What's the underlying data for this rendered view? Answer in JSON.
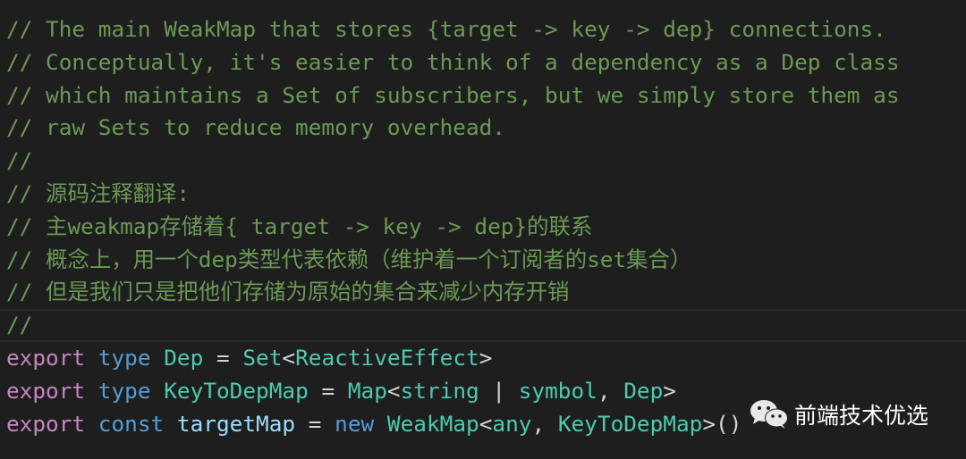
{
  "colors": {
    "background": "#1e1e1e",
    "comment": "#6a9955",
    "keyword": "#c586c0",
    "storage": "#569cd6",
    "type": "#4ec9b0",
    "variable": "#9cdcfe",
    "text": "#d4d4d4"
  },
  "code": {
    "current_line": 9,
    "lines": [
      {
        "tokens": [
          {
            "text": "// The main WeakMap that stores {target -> key -> dep} connections.",
            "cls": "comment"
          }
        ]
      },
      {
        "tokens": [
          {
            "text": "// Conceptually, it's easier to think of a dependency as a Dep class",
            "cls": "comment"
          }
        ]
      },
      {
        "tokens": [
          {
            "text": "// which maintains a Set of subscribers, but we simply store them as",
            "cls": "comment"
          }
        ]
      },
      {
        "tokens": [
          {
            "text": "// raw Sets to reduce memory overhead.",
            "cls": "comment"
          }
        ]
      },
      {
        "tokens": [
          {
            "text": "//",
            "cls": "comment"
          }
        ]
      },
      {
        "tokens": [
          {
            "text": "// 源码注释翻译:",
            "cls": "comment"
          }
        ]
      },
      {
        "tokens": [
          {
            "text": "// 主weakmap存储着{ target -> key -> dep}的联系",
            "cls": "comment"
          }
        ]
      },
      {
        "tokens": [
          {
            "text": "// 概念上，用一个dep类型代表依赖（维护着一个订阅者的set集合）",
            "cls": "comment"
          }
        ]
      },
      {
        "tokens": [
          {
            "text": "// 但是我们只是把他们存储为原始的集合来减少内存开销",
            "cls": "comment"
          }
        ]
      },
      {
        "tokens": [
          {
            "text": "//",
            "cls": "comment"
          }
        ]
      },
      {
        "tokens": [
          {
            "text": "export",
            "cls": "kw"
          },
          {
            "text": " ",
            "cls": "punct"
          },
          {
            "text": "type",
            "cls": "storage"
          },
          {
            "text": " ",
            "cls": "punct"
          },
          {
            "text": "Dep",
            "cls": "type"
          },
          {
            "text": " = ",
            "cls": "punct"
          },
          {
            "text": "Set",
            "cls": "type"
          },
          {
            "text": "<",
            "cls": "punct"
          },
          {
            "text": "ReactiveEffect",
            "cls": "type"
          },
          {
            "text": ">",
            "cls": "punct"
          }
        ]
      },
      {
        "tokens": [
          {
            "text": "export",
            "cls": "kw"
          },
          {
            "text": " ",
            "cls": "punct"
          },
          {
            "text": "type",
            "cls": "storage"
          },
          {
            "text": " ",
            "cls": "punct"
          },
          {
            "text": "KeyToDepMap",
            "cls": "type"
          },
          {
            "text": " = ",
            "cls": "punct"
          },
          {
            "text": "Map",
            "cls": "type"
          },
          {
            "text": "<",
            "cls": "punct"
          },
          {
            "text": "string",
            "cls": "type"
          },
          {
            "text": " | ",
            "cls": "punct"
          },
          {
            "text": "symbol",
            "cls": "type"
          },
          {
            "text": ", ",
            "cls": "punct"
          },
          {
            "text": "Dep",
            "cls": "type"
          },
          {
            "text": ">",
            "cls": "punct"
          }
        ]
      },
      {
        "tokens": [
          {
            "text": "export",
            "cls": "kw"
          },
          {
            "text": " ",
            "cls": "punct"
          },
          {
            "text": "const",
            "cls": "storage"
          },
          {
            "text": " ",
            "cls": "punct"
          },
          {
            "text": "targetMap",
            "cls": "var"
          },
          {
            "text": " = ",
            "cls": "punct"
          },
          {
            "text": "new",
            "cls": "storage"
          },
          {
            "text": " ",
            "cls": "punct"
          },
          {
            "text": "WeakMap",
            "cls": "type"
          },
          {
            "text": "<",
            "cls": "punct"
          },
          {
            "text": "any",
            "cls": "type"
          },
          {
            "text": ", ",
            "cls": "punct"
          },
          {
            "text": "KeyToDepMap",
            "cls": "type"
          },
          {
            "text": ">()",
            "cls": "punct"
          }
        ]
      }
    ]
  },
  "watermark": {
    "icon": "wechat-icon",
    "text": "前端技术优选"
  }
}
